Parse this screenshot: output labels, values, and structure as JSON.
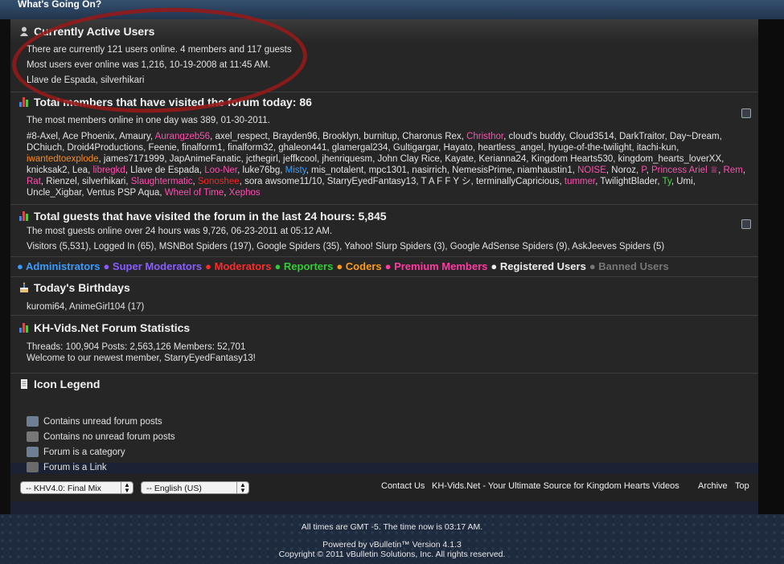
{
  "top_title": "What's Going On?",
  "active": {
    "title": "Currently Active Users",
    "line1": "There are currently 121 users online. 4 members and 117 guests",
    "line2": "Most users ever online was 1,216, 10-19-2008 at 11:45 AM.",
    "line3": "Llave de Espada, silverhikari"
  },
  "today": {
    "title": "Total members that have visited the forum today: 86",
    "line1": "The most members online in one day was 389, 01-30-2011.",
    "members": [
      {
        "name": "#8-Axel",
        "color": ""
      },
      {
        "name": "Ace Phoenix",
        "color": ""
      },
      {
        "name": "Amaury",
        "color": ""
      },
      {
        "name": "Aurangzeb56",
        "color": "#ff4db0"
      },
      {
        "name": "axel_respect",
        "color": ""
      },
      {
        "name": "Brayden96",
        "color": ""
      },
      {
        "name": "Brooklyn",
        "color": ""
      },
      {
        "name": "burnitup",
        "color": ""
      },
      {
        "name": "Charonus Rex",
        "color": ""
      },
      {
        "name": "Christhor",
        "color": "#ff4db0"
      },
      {
        "name": "cloud's buddy",
        "color": ""
      },
      {
        "name": "Cloud3514",
        "color": ""
      },
      {
        "name": "DarkTraitor",
        "color": ""
      },
      {
        "name": "Day~Dream",
        "color": ""
      },
      {
        "name": "DChiuch",
        "color": ""
      },
      {
        "name": "Droid4Productions",
        "color": ""
      },
      {
        "name": "Feenie",
        "color": ""
      },
      {
        "name": "finalform1",
        "color": ""
      },
      {
        "name": "finalform32",
        "color": ""
      },
      {
        "name": "ghaleon441",
        "color": ""
      },
      {
        "name": "glamergal234",
        "color": ""
      },
      {
        "name": "Gultigargar",
        "color": ""
      },
      {
        "name": "Hayato",
        "color": ""
      },
      {
        "name": "heartless_angel",
        "color": ""
      },
      {
        "name": "hyuge-of-the-twilight",
        "color": ""
      },
      {
        "name": "itachi-kun",
        "color": ""
      },
      {
        "name": "iwantedtoexplode",
        "color": "#ff8a1a"
      },
      {
        "name": "james7171999",
        "color": ""
      },
      {
        "name": "JapAnimeFanatic",
        "color": ""
      },
      {
        "name": "jcthegirl",
        "color": ""
      },
      {
        "name": "jeffkcool",
        "color": ""
      },
      {
        "name": "jhenriquesm",
        "color": ""
      },
      {
        "name": "John Clay Rice",
        "color": ""
      },
      {
        "name": "Kayate",
        "color": ""
      },
      {
        "name": "Kerianna24",
        "color": ""
      },
      {
        "name": "Kingdom Hearts530",
        "color": ""
      },
      {
        "name": "kingdom_hearts_loverXX",
        "color": ""
      },
      {
        "name": "knicksak2",
        "color": ""
      },
      {
        "name": "Lea",
        "color": ""
      },
      {
        "name": "libregkd",
        "color": "#ff4db0"
      },
      {
        "name": "Llave de Espada",
        "color": ""
      },
      {
        "name": "Loo-Ner",
        "color": "#ff4db0"
      },
      {
        "name": "luke76bg",
        "color": ""
      },
      {
        "name": "Misty",
        "color": "#3aa0ff"
      },
      {
        "name": "mis_notalent",
        "color": ""
      },
      {
        "name": "mpc1301",
        "color": ""
      },
      {
        "name": "nasirrich",
        "color": ""
      },
      {
        "name": "NemesisPrime",
        "color": ""
      },
      {
        "name": "niamhaustin1",
        "color": ""
      },
      {
        "name": "NOISE",
        "color": "#ff4db0"
      },
      {
        "name": "Noroz",
        "color": ""
      },
      {
        "name": "P",
        "color": "#ff4db0"
      },
      {
        "name": "Princess Ariel ♕",
        "color": "#ff4db0"
      },
      {
        "name": "Rem",
        "color": "#ff4db0"
      },
      {
        "name": "Rat",
        "color": "#ff4db0"
      },
      {
        "name": "Rienzel",
        "color": ""
      },
      {
        "name": "silverhikari",
        "color": ""
      },
      {
        "name": "Slaughtermatic",
        "color": "#ff4db0"
      },
      {
        "name": "Sonoshee",
        "color": "#ff2020"
      },
      {
        "name": "sora awsome11/10",
        "color": ""
      },
      {
        "name": "StarryEyedFantasy13",
        "color": ""
      },
      {
        "name": "T A F F Y シ",
        "color": ""
      },
      {
        "name": "terminallyCapricious",
        "color": ""
      },
      {
        "name": "tummer",
        "color": "#ff4db0"
      },
      {
        "name": "TwilightBlader",
        "color": ""
      },
      {
        "name": "Ty",
        "color": "#44dd44"
      },
      {
        "name": "Umi",
        "color": ""
      },
      {
        "name": "Uncle_Xigbar",
        "color": ""
      },
      {
        "name": "Ventus PSP Aqua",
        "color": ""
      },
      {
        "name": "Wheel of Time",
        "color": "#ff4db0"
      },
      {
        "name": "Xephos",
        "color": "#ff4db0"
      }
    ]
  },
  "guests": {
    "title": "Total guests that have visited the forum in the last 24 hours: 5,845",
    "line1": "The most guests online over 24 hours was 9,726, 06-23-2011 at 05:12 AM.",
    "line2": "Visitors (5,531),   Logged In (65),   MSNBot Spiders (197),   Google Spiders (35),   Yahoo! Slurp Spiders (3),   Google AdSense Spiders (9),   AskJeeves Spiders (5)"
  },
  "groups": [
    {
      "label": "Administrators",
      "color": "#3a9bff"
    },
    {
      "label": "Super Moderators",
      "color": "#8a5cff"
    },
    {
      "label": "Moderators",
      "color": "#ff2a2a"
    },
    {
      "label": "Reporters",
      "color": "#33cc33"
    },
    {
      "label": "Coders",
      "color": "#ff9a1a"
    },
    {
      "label": "Premium Members",
      "color": "#ff3aa5"
    },
    {
      "label": "Registered Users",
      "color": "#eeeeee"
    },
    {
      "label": "Banned Users",
      "color": "#777777"
    }
  ],
  "birthdays": {
    "title": "Today's Birthdays",
    "line1": "kuromi64, AnimeGirl104 (17)"
  },
  "stats": {
    "title": "KH-Vids.Net Forum Statistics",
    "line1": "Threads: 100,904   Posts: 2,563,126   Members: 52,701",
    "line2": "Welcome to our newest member, StarryEyedFantasy13!"
  },
  "icon_legend": {
    "title": "Icon Legend",
    "items": [
      {
        "label": "Contains unread forum posts",
        "icon": "unread-forum-icon",
        "color": "#6d7f93"
      },
      {
        "label": "Contains no unread forum posts",
        "icon": "read-forum-icon",
        "color": "#777"
      },
      {
        "label": "Forum is a category",
        "icon": "category-icon",
        "color": "#6d7f93"
      },
      {
        "label": "Forum is a Link",
        "icon": "link-icon",
        "color": "#6a6a6a"
      }
    ]
  },
  "footer": {
    "style_select": "-- KHV4.0: Final Mix",
    "language_select": "-- English (US)",
    "links": {
      "contact": "Contact Us",
      "home": "KH-Vids.Net - Your Ultimate Source for Kingdom Hearts Videos",
      "archive": "Archive",
      "top": "Top"
    }
  },
  "bottom": {
    "time": "All times are GMT -5. The time now is 03:17 AM.",
    "powered": "Powered by vBulletin™ Version 4.1.3",
    "copyright": "Copyright © 2011 vBulletin Solutions, Inc. All rights reserved."
  }
}
